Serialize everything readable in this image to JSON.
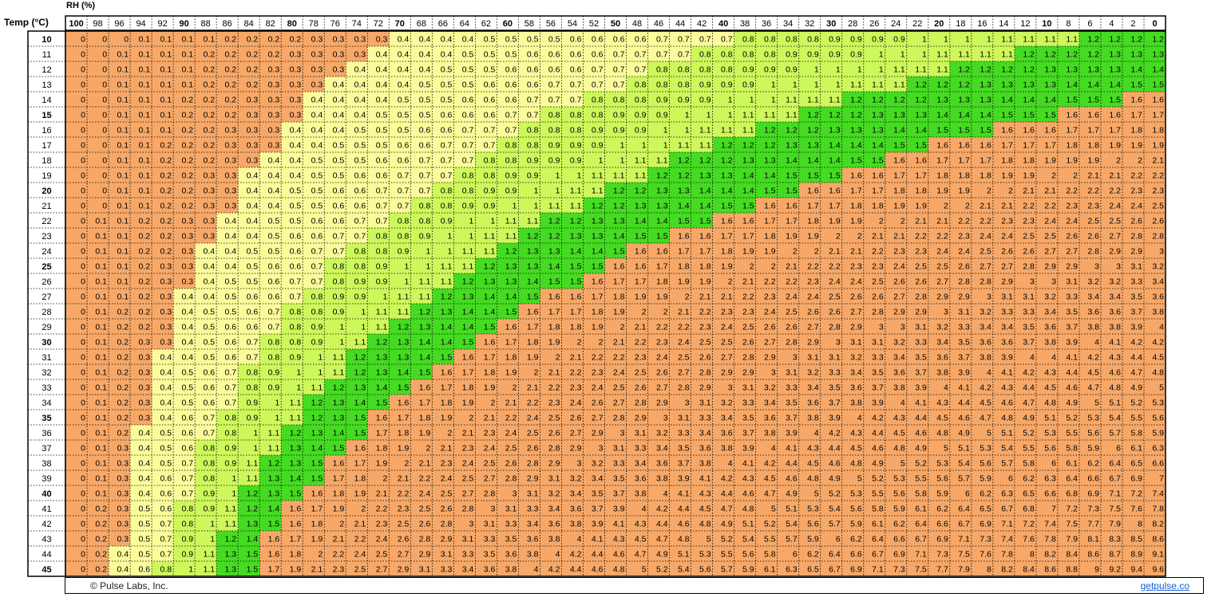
{
  "chart_data": {
    "type": "heatmap",
    "title": "",
    "xlabel": "RH (%)",
    "ylabel": "Temp (°C)",
    "x": [
      100,
      98,
      96,
      94,
      92,
      90,
      88,
      86,
      84,
      82,
      80,
      78,
      76,
      74,
      72,
      70,
      68,
      66,
      64,
      62,
      60,
      58,
      56,
      54,
      52,
      50,
      48,
      46,
      44,
      42,
      40,
      38,
      36,
      34,
      32,
      30,
      28,
      26,
      24,
      22,
      20,
      18,
      16,
      14,
      12,
      10,
      8,
      6,
      4,
      2,
      0
    ],
    "y": [
      10,
      11,
      12,
      13,
      14,
      15,
      16,
      17,
      18,
      19,
      20,
      21,
      22,
      23,
      24,
      25,
      26,
      27,
      28,
      29,
      30,
      31,
      32,
      33,
      34,
      35,
      36,
      37,
      38,
      39,
      40,
      41,
      42,
      43,
      44,
      45
    ],
    "bold_x": [
      100,
      90,
      80,
      70,
      60,
      50,
      40,
      30,
      20,
      10,
      0
    ],
    "bold_y": [
      10,
      15,
      20,
      25,
      30,
      35,
      40,
      45
    ],
    "value_precision": 1,
    "color_bands": [
      {
        "min": 0.0,
        "max": 0.4,
        "color": "#f7a868"
      },
      {
        "min": 0.4,
        "max": 0.8,
        "color": "#fbfb9b"
      },
      {
        "min": 0.8,
        "max": 1.2,
        "color": "#cdf75b"
      },
      {
        "min": 1.2,
        "max": 1.6,
        "color": "#45db22"
      },
      {
        "min": 1.6,
        "max": 99,
        "color": "#f7a868"
      }
    ],
    "grid": true,
    "legend": "none"
  },
  "footer": {
    "copyright": "© Pulse Labs, Inc.",
    "link": "getpulse.co"
  }
}
